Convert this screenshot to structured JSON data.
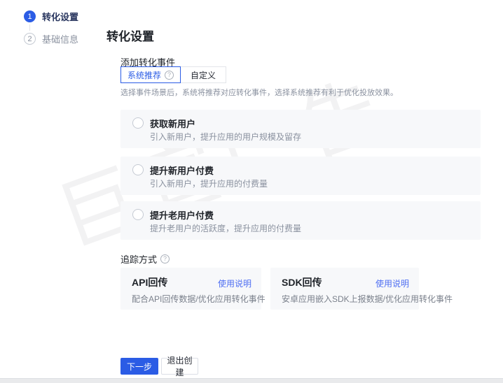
{
  "watermark": "巨宣广告",
  "steps": {
    "items": [
      {
        "number": "1",
        "label": "转化设置"
      },
      {
        "number": "2",
        "label": "基础信息"
      }
    ]
  },
  "main": {
    "title": "转化设置",
    "add_event": {
      "label": "添加转化事件",
      "tabs": [
        {
          "label": "系统推荐",
          "selected": true
        },
        {
          "label": "自定义",
          "selected": false
        }
      ],
      "hint": "选择事件场景后，系统将推荐对应转化事件，选择系统推荐有利于优化投放效果。",
      "options": [
        {
          "title": "获取新用户",
          "description": "引入新用户，提升应用的用户规模及留存",
          "selected": false
        },
        {
          "title": "提升新用户付费",
          "description": "引入新用户，提升应用的付费量",
          "selected": false
        },
        {
          "title": "提升老用户付费",
          "description": "提升老用户的活跃度，提升应用的付费量",
          "selected": false
        }
      ]
    },
    "tracking": {
      "label": "追踪方式",
      "cards": [
        {
          "title": "API回传",
          "link": "使用说明",
          "description": "配合API回传数据/优化应用转化事件"
        },
        {
          "title": "SDK回传",
          "link": "使用说明",
          "description": "安卓应用嵌入SDK上报数据/优化应用转化事件"
        }
      ]
    },
    "footer": {
      "next_label": "下一步",
      "exit_label": "退出创建"
    }
  },
  "icons": {
    "question_glyph": "?"
  },
  "colors": {
    "primary": "#2b5ce5",
    "link": "#4e6ef2",
    "card_bg": "#f7f8fa",
    "text_dark": "#1f2329",
    "text_gray": "#8a919f"
  }
}
